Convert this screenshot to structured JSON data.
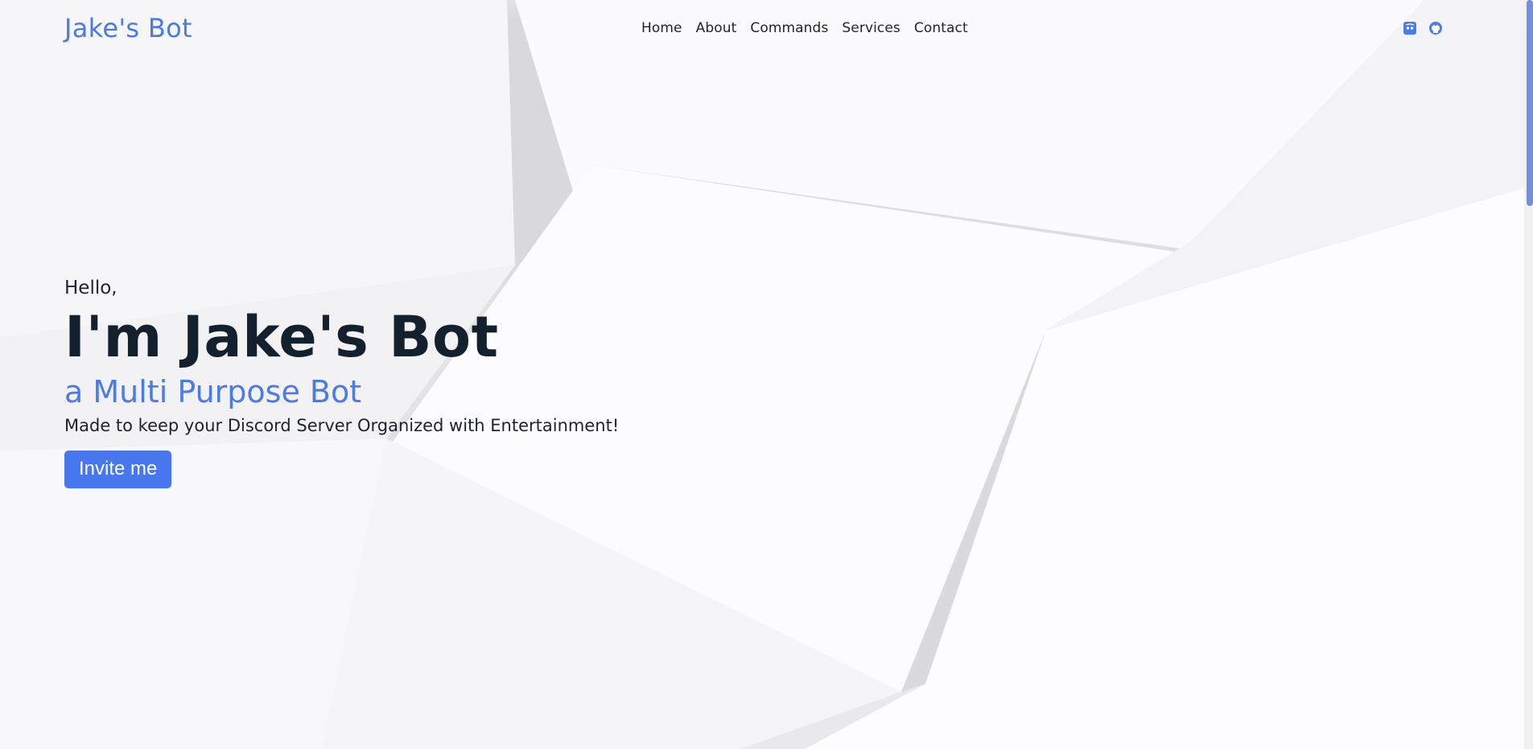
{
  "header": {
    "logo": "Jake's Bot",
    "nav": [
      "Home",
      "About",
      "Commands",
      "Services",
      "Contact"
    ],
    "social_icons": [
      "discord-icon",
      "github-icon"
    ]
  },
  "hero": {
    "greeting": "Hello,",
    "title": "I'm Jake's Bot",
    "subtitle": "a Multi Purpose Bot",
    "tagline": "Made to keep your Discord Server Organized with Entertainment!",
    "cta_label": "Invite me"
  },
  "colors": {
    "accent": "#4a7be8",
    "button": "#4876ee",
    "heading": "#13212e",
    "text": "#1c2430"
  }
}
